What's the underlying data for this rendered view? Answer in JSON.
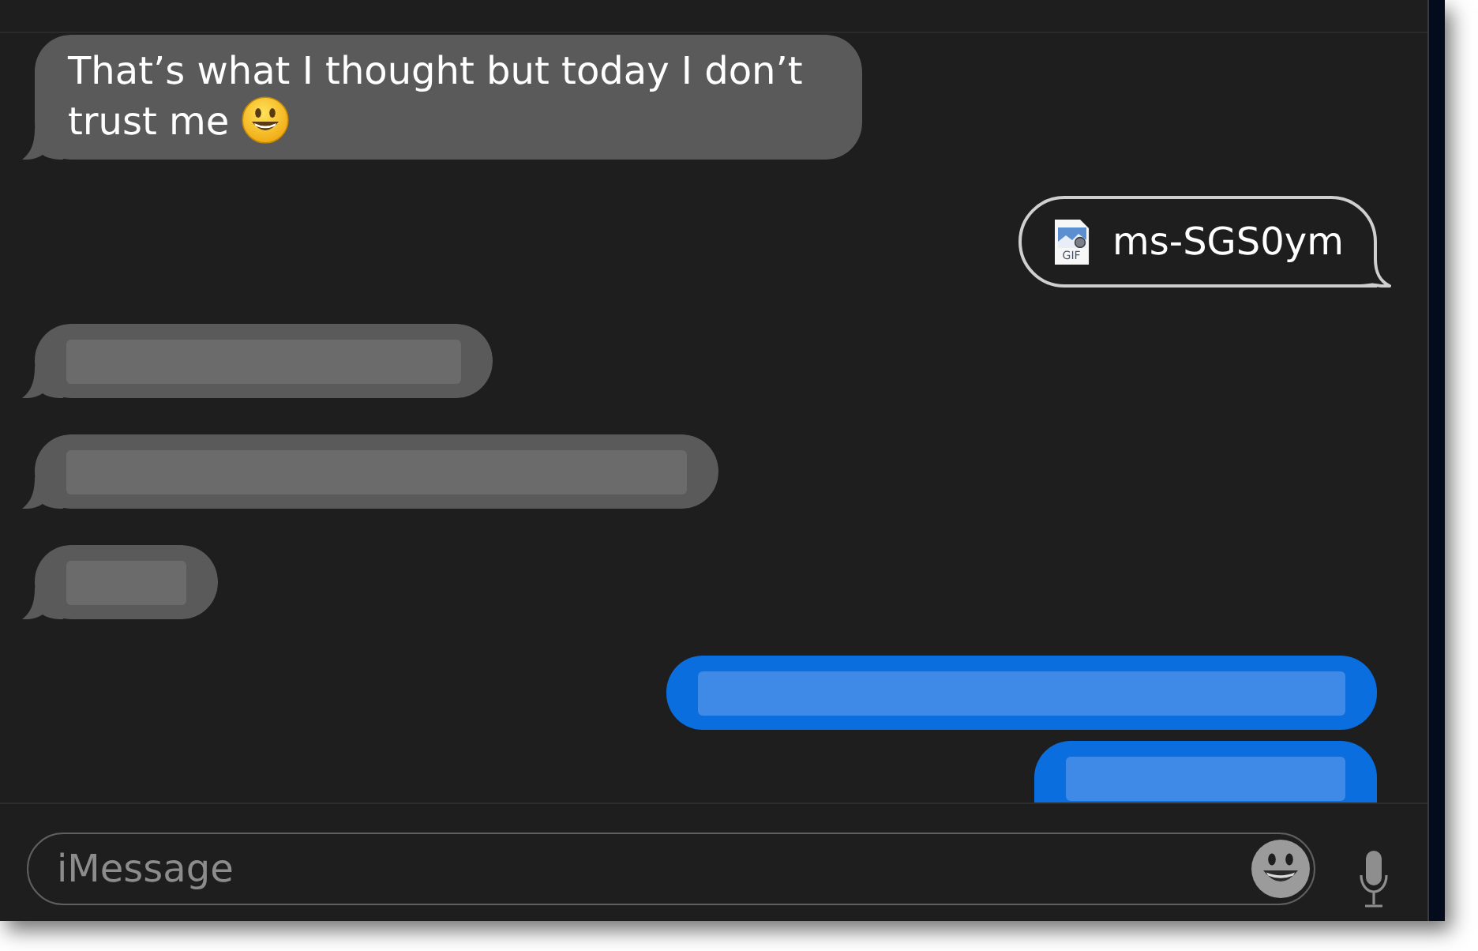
{
  "messages": [
    {
      "kind": "text",
      "outgoing": false,
      "tail": true,
      "cut_off": false,
      "text": "That’s what I thought but today I don’t trust me",
      "emoji": true
    },
    {
      "kind": "attachment",
      "outgoing": true,
      "tail": true,
      "cut_off": false,
      "file_type": "GIF",
      "filename": "ms-SGS0ym"
    },
    {
      "kind": "blurred",
      "outgoing": false,
      "tail": true,
      "cut_off": false
    },
    {
      "kind": "blurred",
      "outgoing": false,
      "tail": true,
      "cut_off": false
    },
    {
      "kind": "blurred",
      "outgoing": false,
      "tail": true,
      "cut_off": false
    },
    {
      "kind": "blurred",
      "outgoing": true,
      "tail": false,
      "cut_off": false
    },
    {
      "kind": "blurred",
      "outgoing": true,
      "tail": false,
      "cut_off": true
    }
  ],
  "composer": {
    "placeholder": "iMessage"
  }
}
